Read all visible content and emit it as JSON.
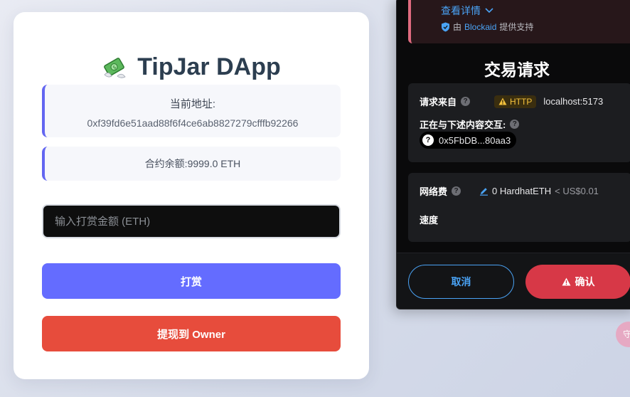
{
  "dapp": {
    "title": "TipJar DApp",
    "title_icon": "money-with-wings-icon",
    "address_label": "当前地址:",
    "address_value": "0xf39fd6e51aad88f6f4ce6ab8827279cfffb92266",
    "balance_text": "合约余额:9999.0 ETH",
    "amount_placeholder": "输入打赏金额 (ETH)",
    "amount_value": "",
    "tip_button": "打赏",
    "withdraw_button": "提现到 Owner",
    "colors": {
      "accent": "#646cff",
      "danger": "#e74c3c",
      "title": "#2c3e50"
    }
  },
  "wallet": {
    "alert": {
      "details_link": "查看详情",
      "provider_prefix": "由",
      "provider_name": "Blockaid",
      "provider_suffix": "提供支持"
    },
    "title": "交易请求",
    "request_from_label": "请求来自",
    "http_badge": "HTTP",
    "origin": "localhost:5173",
    "interacting_label": "正在与下述内容交互:",
    "contract_address": "0x5FbDB...80aa3",
    "network_fee_label": "网络费",
    "fee_amount": "0 HardhatETH",
    "fee_usd": "< US$0.01",
    "speed_label": "速度",
    "cancel_button": "取消",
    "confirm_button": "确认",
    "colors": {
      "link": "#4aa3f5",
      "confirm": "#d73847",
      "warning": "#f5c23c"
    }
  },
  "floating_button": {
    "label": "守"
  }
}
